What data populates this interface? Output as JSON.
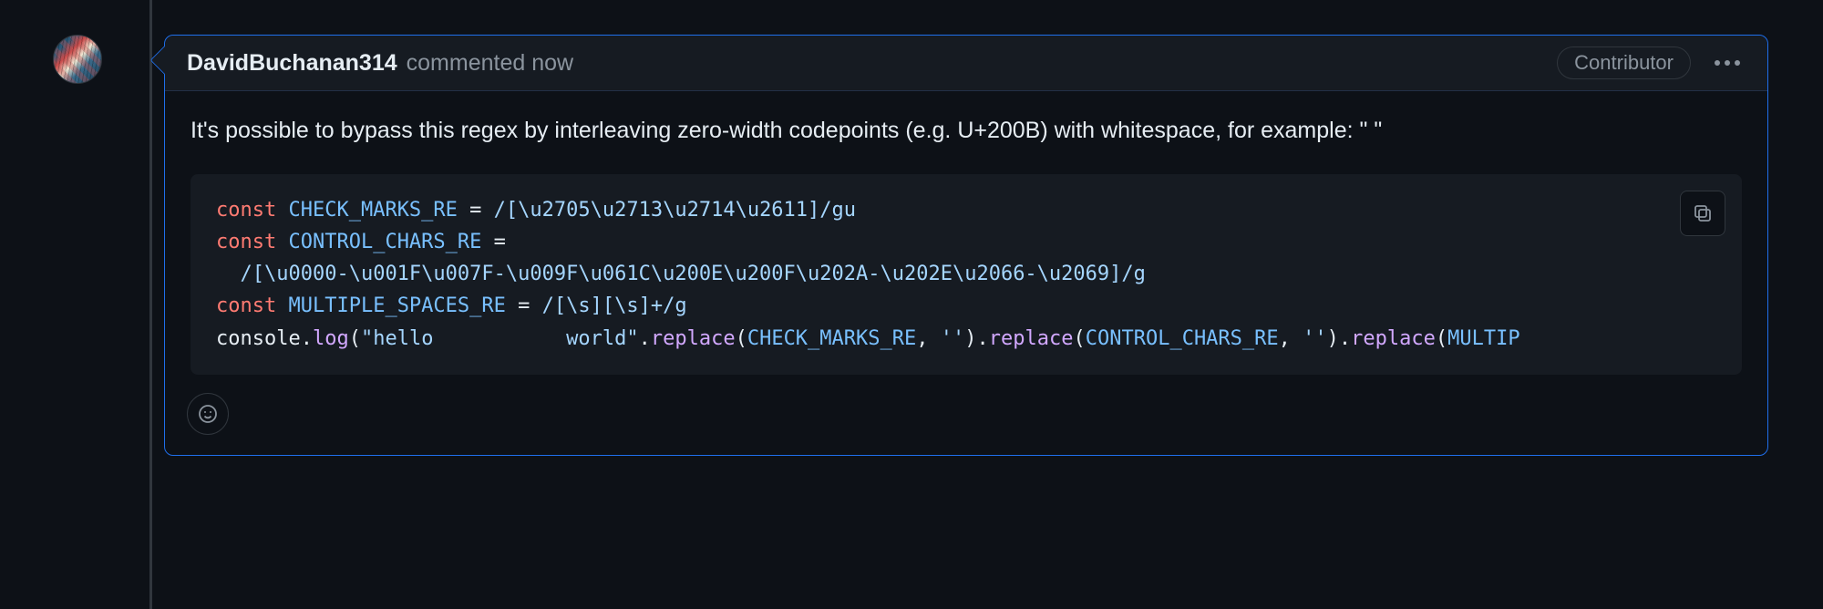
{
  "author": "DavidBuchanan314",
  "commented_label": "commented now",
  "badge": "Contributor",
  "body_text": "It's possible to bypass this regex by interleaving zero-width codepoints (e.g. U+200B) with whitespace, for example: \"    \"",
  "code": {
    "t_const": "const",
    "name1": "CHECK_MARKS_RE",
    "eq": " = ",
    "regex1": "/[\\u2705\\u2713\\u2714\\u2611]/gu",
    "name2": "CONTROL_CHARS_RE",
    "regex2": "/[\\u0000-\\u001F\\u007F-\\u009F\\u061C\\u200E\\u200F\\u202A-\\u202E\\u2066-\\u2069]/g",
    "name3": "MULTIPLE_SPACES_RE",
    "regex3": "/[\\s][\\s]+/g",
    "console": "console.",
    "log": "log",
    "lp": "(",
    "str_hello": "\"hello           world\"",
    "dot": ".",
    "replace": "replace",
    "arg_check": "CHECK_MARKS_RE",
    "comma": ", ",
    "empty": "''",
    "rp": ")",
    "arg_control": "CONTROL_CHARS_RE",
    "arg_multip": "MULTIP",
    "indent": "  "
  },
  "icons": {
    "copy": "copy-icon",
    "react": "smiley-icon",
    "kebab": "kebab-icon"
  }
}
